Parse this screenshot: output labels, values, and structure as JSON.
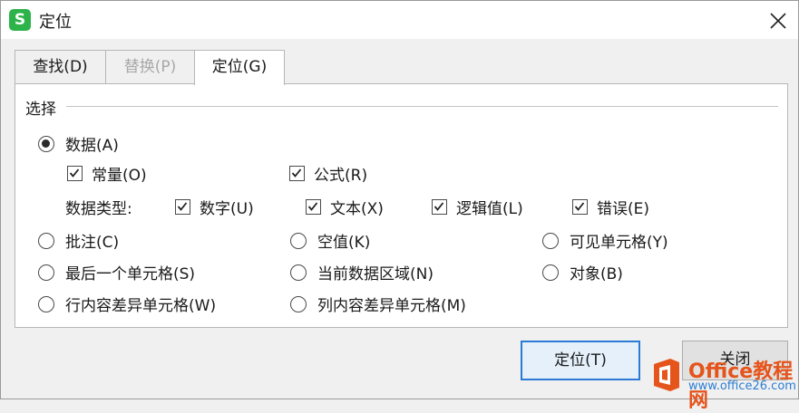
{
  "window": {
    "title": "定位"
  },
  "tabs": [
    {
      "label": "查找(D)",
      "state": "normal"
    },
    {
      "label": "替换(P)",
      "state": "disabled"
    },
    {
      "label": "定位(G)",
      "state": "active"
    }
  ],
  "group": {
    "label": "选择"
  },
  "options": {
    "data": {
      "label": "数据(A)",
      "checked": true
    },
    "constant": {
      "label": "常量(O)",
      "checked": true
    },
    "formula": {
      "label": "公式(R)",
      "checked": true
    },
    "data_type_label": "数据类型:",
    "number": {
      "label": "数字(U)",
      "checked": true
    },
    "text": {
      "label": "文本(X)",
      "checked": true
    },
    "logical": {
      "label": "逻辑值(L)",
      "checked": true
    },
    "error": {
      "label": "错误(E)",
      "checked": true
    },
    "comment": {
      "label": "批注(C)",
      "checked": false
    },
    "blank": {
      "label": "空值(K)",
      "checked": false
    },
    "visible_cells": {
      "label": "可见单元格(Y)",
      "checked": false
    },
    "last_cell": {
      "label": "最后一个单元格(S)",
      "checked": false
    },
    "current_region": {
      "label": "当前数据区域(N)",
      "checked": false
    },
    "objects": {
      "label": "对象(B)",
      "checked": false
    },
    "row_diff": {
      "label": "行内容差异单元格(W)",
      "checked": false
    },
    "col_diff": {
      "label": "列内容差异单元格(M)",
      "checked": false
    }
  },
  "buttons": {
    "locate": "定位(T)",
    "close": "关闭"
  },
  "watermark": {
    "brand": "Office教程网",
    "url": "www.office26.com"
  },
  "colors": {
    "accent": "#2a7ad6",
    "app_icon": "#2db34a",
    "watermark_brand": "#e5541b",
    "watermark_url": "#2d7dd2"
  }
}
